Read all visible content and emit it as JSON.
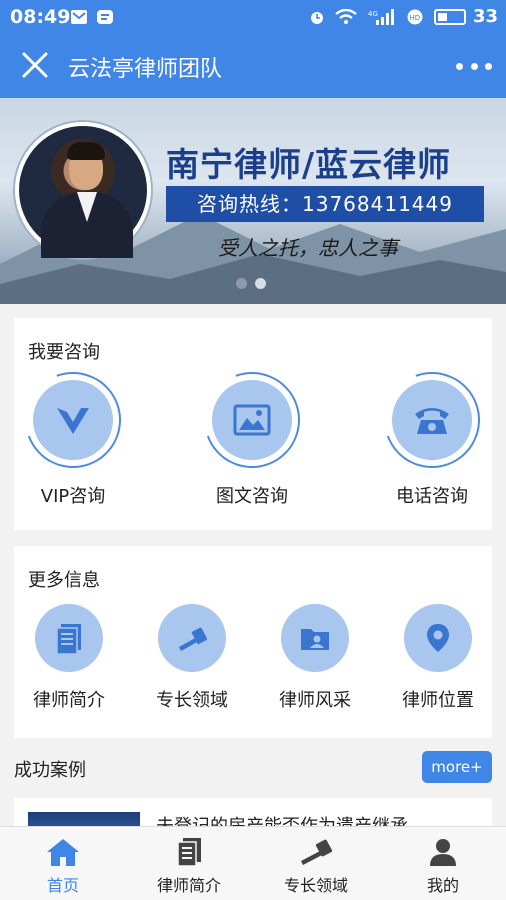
{
  "status_bar": {
    "time": "08:49",
    "battery": "33"
  },
  "nav": {
    "title": "云法亭律师团队"
  },
  "banner": {
    "headline": "南宁律师/蓝云律师",
    "hotline": "咨询热线：13768411449",
    "slogan": "受人之托，忠人之事",
    "slides": 2,
    "active_slide": 2
  },
  "consult": {
    "title": "我要咨询",
    "items": [
      {
        "label": "VIP咨询",
        "icon": "vip-icon"
      },
      {
        "label": "图文咨询",
        "icon": "image-icon"
      },
      {
        "label": "电话咨询",
        "icon": "telephone-icon"
      }
    ]
  },
  "more_info": {
    "title": "更多信息",
    "items": [
      {
        "label": "律师简介",
        "icon": "document-icon"
      },
      {
        "label": "专长领域",
        "icon": "gavel-icon"
      },
      {
        "label": "律师风采",
        "icon": "folder-icon"
      },
      {
        "label": "律师位置",
        "icon": "location-pin-icon"
      }
    ]
  },
  "cases": {
    "title": "成功案例",
    "more_label": "more+",
    "first_case_title": "未登记的房产能否作为遗产继承"
  },
  "tabbar": {
    "items": [
      {
        "label": "首页",
        "icon": "home-icon",
        "active": true
      },
      {
        "label": "律师简介",
        "icon": "document-icon"
      },
      {
        "label": "专长领域",
        "icon": "gavel-icon"
      },
      {
        "label": "我的",
        "icon": "user-icon"
      }
    ]
  },
  "colors": {
    "primary": "#3f86e6",
    "icon_circle": "#a9c6ef",
    "icon_glyph": "#3a76cf"
  }
}
